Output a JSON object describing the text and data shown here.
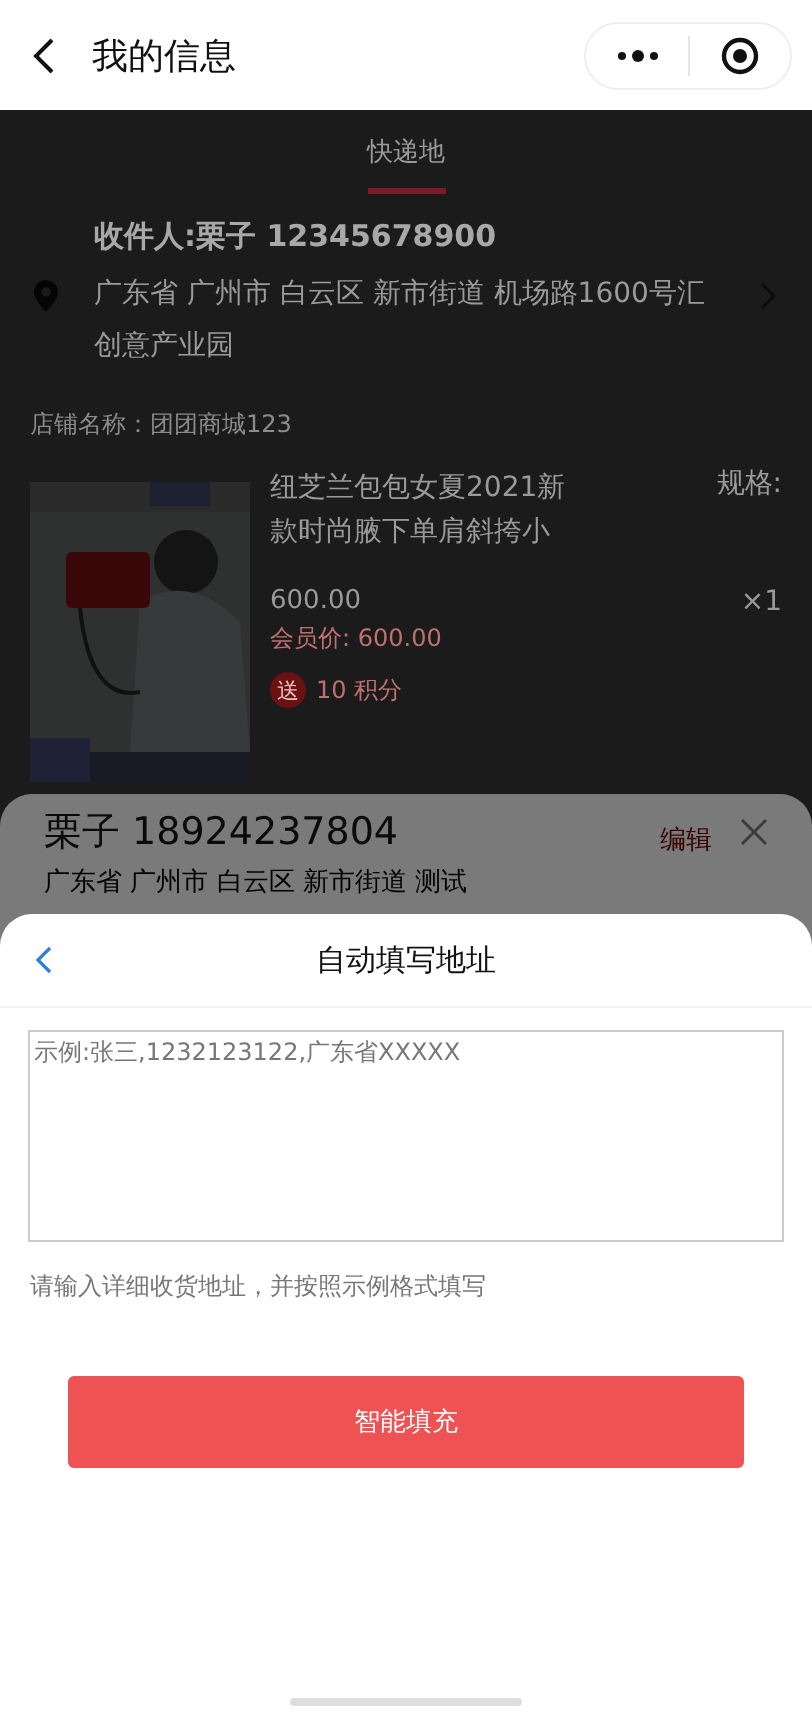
{
  "nav": {
    "title": "我的信息"
  },
  "tabs": [
    {
      "label": "快递地",
      "selected": true
    }
  ],
  "receiver": {
    "name": "收件人:栗子 12345678900",
    "address": "广东省 广州市 白云区 新市街道 机场路1600号汇创意产业园"
  },
  "store": "店铺名称：团团商城123",
  "product": {
    "kind": "picture",
    "title": "纽芝兰包包女夏2021新款时尚腋下单肩斜挎小",
    "spec": "规格:",
    "price": "600.00",
    "quantity": "×1",
    "member_price": "会员价: 600.00",
    "gift_badge": "送",
    "points": "10 积分"
  },
  "address_sheet": {
    "name": "栗子 18924237804",
    "edit": "编辑",
    "address": "广东省 广州市 白云区 新市街道 测试"
  },
  "autofill_sheet": {
    "title": "自动填写地址",
    "placeholder": "示例:张三,1232123122,广东省XXXXX",
    "hint": "请输入详细收货地址，并按照示例格式填写",
    "button": "智能填充"
  }
}
